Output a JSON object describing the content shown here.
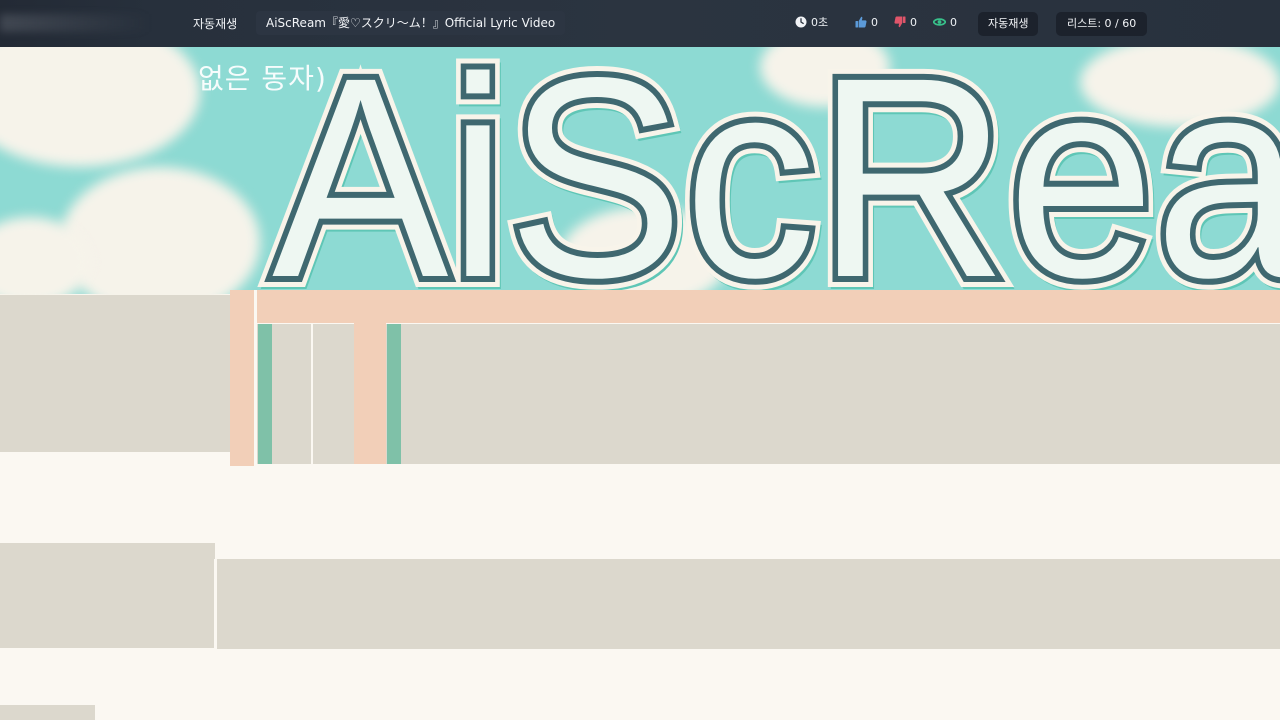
{
  "topbar": {
    "autoplay_title": "자동재생",
    "video_title": "AiScReam『愛♡スクリ～ム！』Official Lyric Video",
    "time": "0초",
    "likes": "0",
    "dislikes": "0",
    "views": "0",
    "autoplay_button": "자동재생",
    "list_counter": "리스트: 0 / 60"
  },
  "video": {
    "logo_text": "AiScRea",
    "overlay_caption": "없은 동자)"
  },
  "colors": {
    "topbar_bg": "#2b3440",
    "cyan_bg": "#8ddad3",
    "logo_dark": "#3f6870",
    "logo_accent": "#5fc6b6",
    "peach": "#f2cfb8",
    "grey_panel": "#dcd8cd",
    "cream": "#fbf8f2",
    "like_blue": "#5b9ad8",
    "dislike_red": "#e0556a",
    "views_green": "#38c08a"
  },
  "icons": {
    "time": "clock-icon",
    "like": "thumbs-up-icon",
    "dislike": "thumbs-down-icon",
    "views": "eye-icon"
  }
}
